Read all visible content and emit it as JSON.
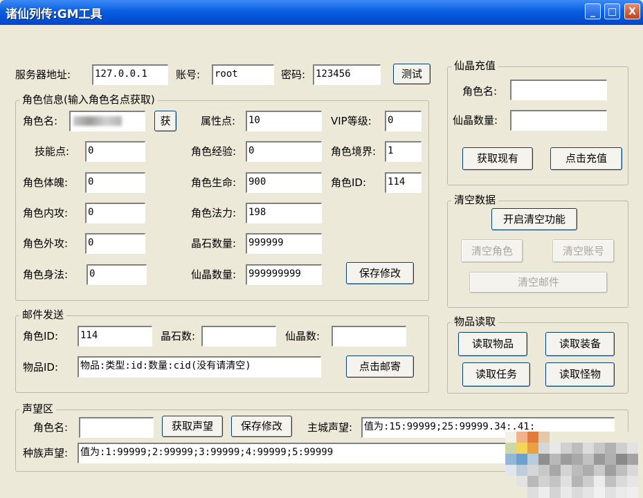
{
  "window": {
    "title": "诸仙列传:GM工具",
    "controls": {
      "minimize": "_",
      "maximize": "□",
      "close": "X"
    }
  },
  "server": {
    "address_label": "服务器地址:",
    "address_value": "127.0.0.1",
    "account_label": "账号:",
    "account_value": "root",
    "password_label": "密码:",
    "password_value": "123456",
    "test_button": "测试"
  },
  "role_info": {
    "legend": "角色信息(输入角色名点获取)",
    "name_label": "角色名:",
    "fetch_button": "获",
    "attr_points_label": "属性点:",
    "attr_points_value": "10",
    "vip_label": "VIP等级:",
    "vip_value": "0",
    "skill_points_label": "技能点:",
    "skill_points_value": "0",
    "exp_label": "角色经验:",
    "exp_value": "0",
    "realm_label": "角色境界:",
    "realm_value": "1",
    "physique_label": "角色体魄:",
    "physique_value": "0",
    "hp_label": "角色生命:",
    "hp_value": "900",
    "role_id_label": "角色ID:",
    "role_id_value": "114",
    "inner_atk_label": "角色内攻:",
    "inner_atk_value": "0",
    "mp_label": "角色法力:",
    "mp_value": "198",
    "outer_atk_label": "角色外攻:",
    "outer_atk_value": "0",
    "crystal_label": "晶石数量:",
    "crystal_value": "999999",
    "agility_label": "角色身法:",
    "agility_value": "0",
    "xianjing_label": "仙晶数量:",
    "xianjing_value": "999999999",
    "save_button": "保存修改"
  },
  "mail": {
    "legend": "邮件发送",
    "role_id_label": "角色ID:",
    "role_id_value": "114",
    "crystal_label": "晶石数:",
    "crystal_value": "",
    "xianjing_label": "仙晶数:",
    "xianjing_value": "",
    "item_label": "物品ID:",
    "item_value": "物品:类型:id:数量:cid(没有请清空)",
    "send_button": "点击邮寄"
  },
  "reputation": {
    "legend": "声望区",
    "name_label": "角色名:",
    "name_value": "",
    "fetch_button": "获取声望",
    "save_button": "保存修改",
    "city_label": "主城声望:",
    "city_value": "值为:15:99999;25:99999.34:.41:",
    "race_label": "种族声望:",
    "race_value": "值为:1:99999;2:99999;3:99999;4:99999;5:99999"
  },
  "recharge": {
    "legend": "仙晶充值",
    "name_label": "角色名:",
    "name_value": "",
    "amount_label": "仙晶数量:",
    "amount_value": "",
    "get_button": "获取现有",
    "recharge_button": "点击充值"
  },
  "clear": {
    "legend": "清空数据",
    "enable_button": "开启清空功能",
    "clear_role_button": "清空角色",
    "clear_account_button": "清空账号",
    "clear_mail_button": "清空邮件"
  },
  "items": {
    "legend": "物品读取",
    "read_items_button": "读取物品",
    "read_equip_button": "读取装备",
    "read_quests_button": "读取任务",
    "read_monsters_button": "读取怪物"
  },
  "colors": {
    "face": "#ece9d8",
    "title_bar": "#0a5fe0",
    "button_border": "#003c74",
    "disabled_text": "#a8a79d"
  }
}
